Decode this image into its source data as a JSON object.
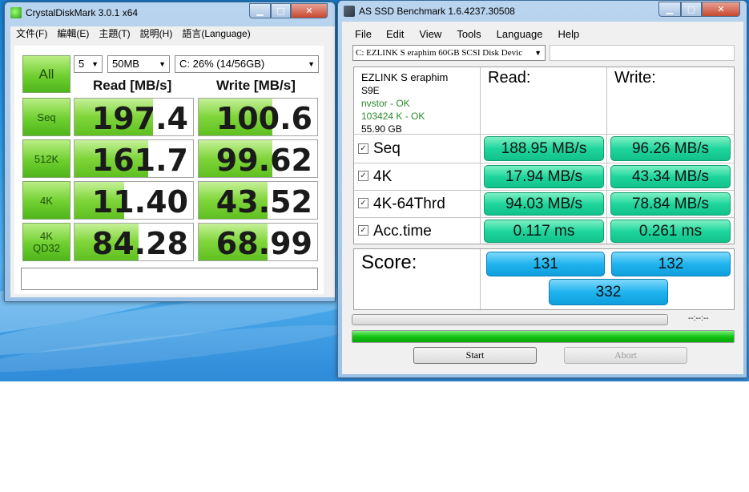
{
  "cdm": {
    "title": "CrystalDiskMark 3.0.1 x64",
    "menu": [
      "文件(F)",
      "編輯(E)",
      "主題(T)",
      "說明(H)",
      "語言(Language)"
    ],
    "all_label": "All",
    "count_value": "5",
    "size_value": "50MB",
    "drive_value": "C: 26% (14/56GB)",
    "read_header": "Read [MB/s]",
    "write_header": "Write [MB/s]",
    "rows": [
      {
        "label": "Seq",
        "read": "197.4",
        "write": "100.6",
        "read_level": 0.66,
        "write_level": 0.62
      },
      {
        "label": "512K",
        "read": "161.7",
        "write": "99.62",
        "read_level": 0.62,
        "write_level": 0.62
      },
      {
        "label": "4K",
        "read": "11.40",
        "write": "43.52",
        "read_level": 0.42,
        "write_level": 0.58
      },
      {
        "label_line1": "4K",
        "label_line2": "QD32",
        "read": "84.28",
        "write": "68.99",
        "read_level": 0.54,
        "write_level": 0.58
      }
    ]
  },
  "asssd": {
    "title": "AS SSD Benchmark 1.6.4237.30508",
    "menu": [
      "File",
      "Edit",
      "View",
      "Tools",
      "Language",
      "Help"
    ],
    "drive_select": "C: EZLINK S eraphim 60GB SCSI Disk Devic",
    "info": {
      "model": "EZLINK S eraphim",
      "firmware": "S9E",
      "driver": "nvstor - OK",
      "alignment": "103424 K - OK",
      "capacity": "55.90 GB"
    },
    "read_header": "Read:",
    "write_header": "Write:",
    "rows": [
      {
        "label": "Seq",
        "read": "188.95 MB/s",
        "write": "96.26 MB/s",
        "checked": true
      },
      {
        "label": "4K",
        "read": "17.94 MB/s",
        "write": "43.34 MB/s",
        "checked": true
      },
      {
        "label": "4K-64Thrd",
        "read": "94.03 MB/s",
        "write": "78.84 MB/s",
        "checked": true
      },
      {
        "label": "Acc.time",
        "read": "0.117 ms",
        "write": "0.261 ms",
        "checked": true
      }
    ],
    "score_label": "Score:",
    "score_read": "131",
    "score_write": "132",
    "score_total": "332",
    "time_text": "--:--:--",
    "progress_level": 1.0,
    "start_label": "Start",
    "abort_label": "Abort",
    "check_glyph": "✓"
  }
}
